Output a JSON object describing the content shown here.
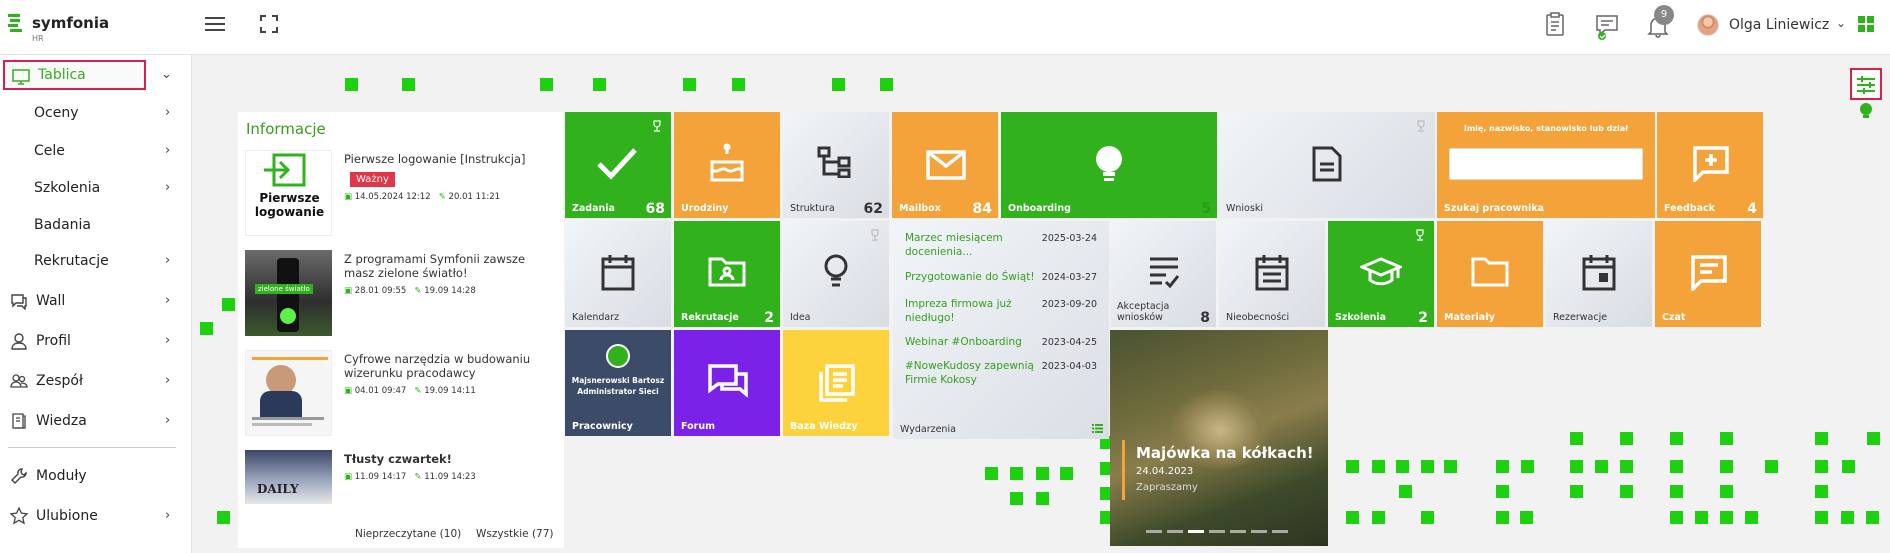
{
  "app": {
    "name": "symfonia",
    "sub": "HR"
  },
  "topbar": {
    "notifications_count": "9",
    "user_name": "Olga Liniewicz"
  },
  "sidebar": {
    "items": [
      {
        "label": "Tablica",
        "icon": "monitor-icon",
        "chev": "⌄",
        "active": true
      },
      {
        "label": "Oceny",
        "chev": "›"
      },
      {
        "label": "Cele",
        "chev": "›"
      },
      {
        "label": "Szkolenia",
        "chev": "›"
      },
      {
        "label": "Badania",
        "chev": ""
      },
      {
        "label": "Rekrutacje",
        "chev": "›"
      },
      {
        "label": "Wall",
        "icon": "chat-icon",
        "chev": "›"
      },
      {
        "label": "Profil",
        "icon": "user-icon",
        "chev": "›"
      },
      {
        "label": "Zespół",
        "icon": "team-icon",
        "chev": "›"
      },
      {
        "label": "Wiedza",
        "icon": "book-icon",
        "chev": "›"
      },
      {
        "label": "Moduły",
        "icon": "wrench-icon",
        "chev": ""
      },
      {
        "label": "Ulubione",
        "icon": "star-icon",
        "chev": "›"
      }
    ]
  },
  "info": {
    "title": "Informacje",
    "items": [
      {
        "title": "Pierwsze logowanie [Instrukcja]",
        "badge": "Ważny",
        "created": "14.05.2024 12:12",
        "edited": "20.01 11:21",
        "thumb_text": "Pierwsze logowanie"
      },
      {
        "title": "Z programami Symfonii zawsze masz zielone światło!",
        "created": "28.01 09:55",
        "edited": "19.09 14:28",
        "thumb_text": "zielone światło"
      },
      {
        "title": "Cyfrowe narzędzia w budowaniu wizerunku pracodawcy",
        "created": "04.01 09:47",
        "edited": "19.09 14:11"
      },
      {
        "title": "Tłusty czwartek!",
        "created": "11.09 14:17",
        "edited": "11.09 14:23",
        "thumb_text": "DAILY"
      }
    ],
    "footer_unread": "Nieprzeczytane (10)",
    "footer_all": "Wszystkie (77)"
  },
  "tiles": {
    "zadania": {
      "label": "Zadania",
      "count": "68"
    },
    "urodziny": {
      "label": "Urodziny"
    },
    "struktura": {
      "label": "Struktura",
      "count": "62"
    },
    "mailbox": {
      "label": "Mailbox",
      "count": "84"
    },
    "onboarding": {
      "label": "Onboarding",
      "count": "5"
    },
    "wnioski": {
      "label": "Wnioski"
    },
    "szukaj": {
      "label": "Szukaj pracownika",
      "placeholder": "Imię, nazwisko, stanowisko lub dział"
    },
    "feedback": {
      "label": "Feedback",
      "count": "4"
    },
    "kalendarz": {
      "label": "Kalendarz"
    },
    "rekrutacje": {
      "label": "Rekrutacje",
      "count": "2"
    },
    "idea": {
      "label": "Idea"
    },
    "akceptacja": {
      "label": "Akceptacja wniosków",
      "count": "8"
    },
    "nieobecnosci": {
      "label": "Nieobecności"
    },
    "szkolenia": {
      "label": "Szkolenia",
      "count": "2"
    },
    "materialy": {
      "label": "Materiały"
    },
    "rezerwacje": {
      "label": "Rezerwacje"
    },
    "czat": {
      "label": "Czat"
    },
    "pracownicy": {
      "label": "Pracownicy",
      "person": "Majsnerowski Bartosz",
      "role": "Administrator Sieci"
    },
    "forum": {
      "label": "Forum"
    },
    "baza": {
      "label": "Baza Wiedzy"
    }
  },
  "events": {
    "label": "Wydarzenia",
    "items": [
      {
        "title": "Marzec miesiącem docenienia...",
        "date": "2025-03-24"
      },
      {
        "title": "Przygotowanie do Świąt!",
        "date": "2024-03-27"
      },
      {
        "title": "Impreza firmowa już niedługo!",
        "date": "2023-09-20"
      },
      {
        "title": "Webinar #Onboarding",
        "date": "2023-04-25"
      },
      {
        "title": "#NoweKudosy zapewnią Firmie Kokosy",
        "date": "2023-04-03"
      }
    ]
  },
  "promo": {
    "title": "Majówka na kółkach!",
    "date": "24.04.2023",
    "sub": "Zapraszamy"
  },
  "colors": {
    "accent": "#31b21c",
    "orange": "#f3a33a",
    "purple": "#7a22e8",
    "yellow": "#fcd33c",
    "navy": "#3b4b68",
    "highlight": "#d8204a"
  }
}
